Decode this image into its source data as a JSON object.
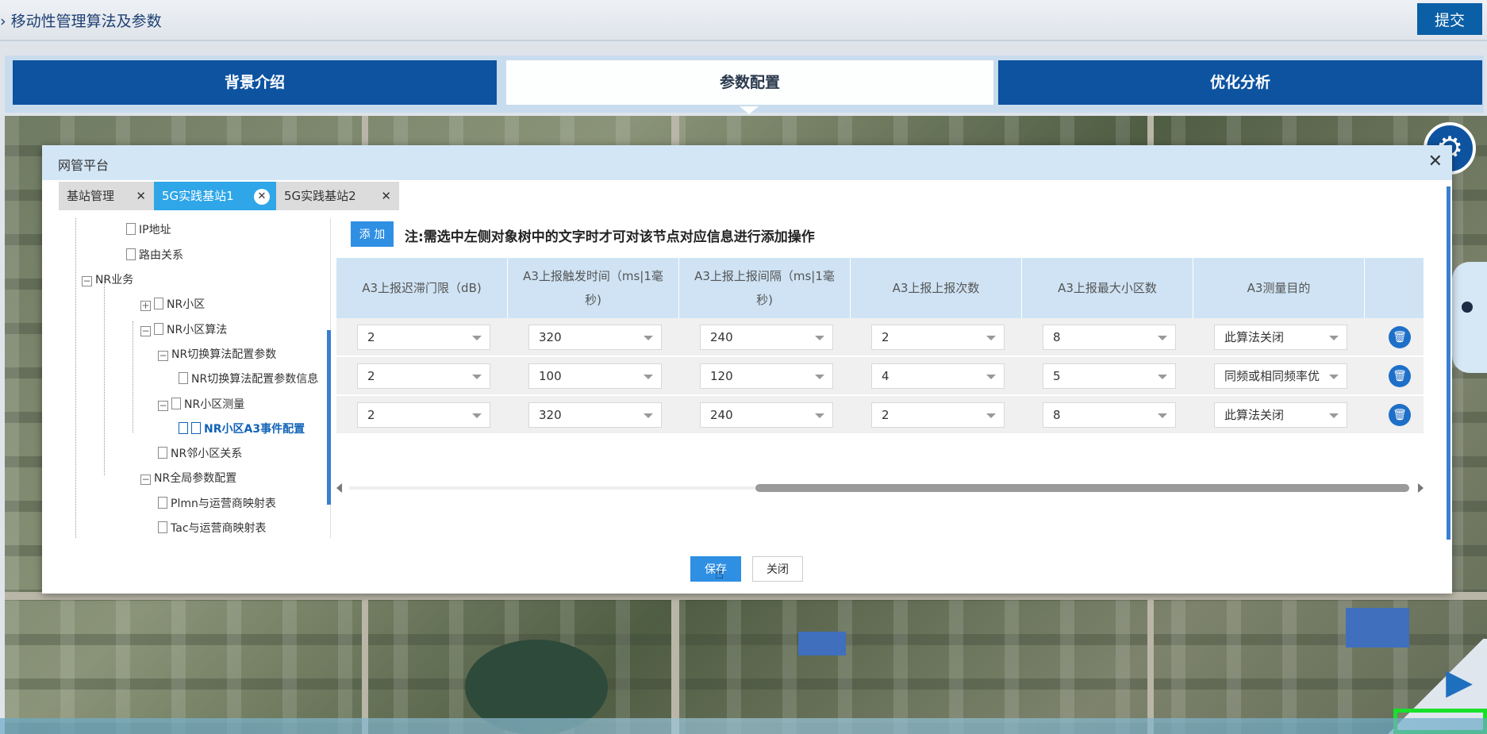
{
  "header": {
    "title": "› 移动性管理算法及参数",
    "submit_label": "提交"
  },
  "main_tabs": [
    {
      "label": "背景介绍"
    },
    {
      "label": "参数配置"
    },
    {
      "label": "优化分析"
    }
  ],
  "dialog": {
    "title": "网管平台",
    "close_glyph": "✕",
    "tabs": [
      {
        "label": "基站管理",
        "close": "✕"
      },
      {
        "label": "5G实践基站1",
        "close": "✕"
      },
      {
        "label": "5G实践基站2",
        "close": "✕"
      }
    ],
    "tree": [
      {
        "label": "IP地址"
      },
      {
        "label": "路由关系"
      },
      {
        "label": "NR业务",
        "toggle": "−"
      },
      {
        "label": "NR小区",
        "toggle": "+"
      },
      {
        "label": "NR小区算法",
        "toggle": "−"
      },
      {
        "label": "NR切换算法配置参数",
        "toggle": "−"
      },
      {
        "label": "NR切换算法配置参数信息"
      },
      {
        "label": "NR小区测量",
        "toggle": "−"
      },
      {
        "label": "NR小区A3事件配置"
      },
      {
        "label": "NR邻小区关系"
      },
      {
        "label": "NR全局参数配置",
        "toggle": "−"
      },
      {
        "label": "Plmn与运营商映射表"
      },
      {
        "label": "Tac与运营商映射表"
      }
    ],
    "add_label": "添 加",
    "note": "注:需选中左侧对象树中的文字时才可对该节点对应信息进行添加操作",
    "columns": [
      "A3上报迟滞门限（dB)",
      "A3上报触发时间（ms|1毫秒)",
      "A3上报上报间隔（ms|1毫秒)",
      "A3上报上报次数",
      "A3上报最大小区数",
      "A3测量目的"
    ],
    "rows": [
      [
        "2",
        "320",
        "240",
        "2",
        "8",
        "此算法关闭"
      ],
      [
        "2",
        "100",
        "120",
        "4",
        "5",
        "同频或相同频率优"
      ],
      [
        "2",
        "320",
        "240",
        "2",
        "8",
        "此算法关闭"
      ]
    ],
    "save_label": "保存",
    "close_label": "关闭"
  },
  "icons": {
    "gear": "⚙",
    "video": "▶",
    "delete": "🗑"
  },
  "colors": {
    "primary": "#0d53a0",
    "accent": "#2f8fe3",
    "header_bg": "#d3e6f5"
  }
}
